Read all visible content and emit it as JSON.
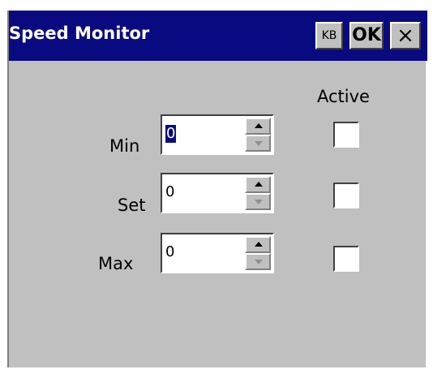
{
  "window": {
    "title": "Speed Monitor",
    "buttons": {
      "kb": "KB",
      "ok": "OK",
      "close": "×"
    }
  },
  "form": {
    "active_header": "Active",
    "rows": [
      {
        "label": "Min",
        "value": "0",
        "selected": true,
        "active": false
      },
      {
        "label": "Set",
        "value": "0",
        "selected": false,
        "active": false
      },
      {
        "label": "Max",
        "value": "0",
        "selected": false,
        "active": false
      }
    ]
  },
  "colors": {
    "titlebar": "#0a0a80",
    "face": "#c0c0c0",
    "selection": "#0a0a80"
  }
}
